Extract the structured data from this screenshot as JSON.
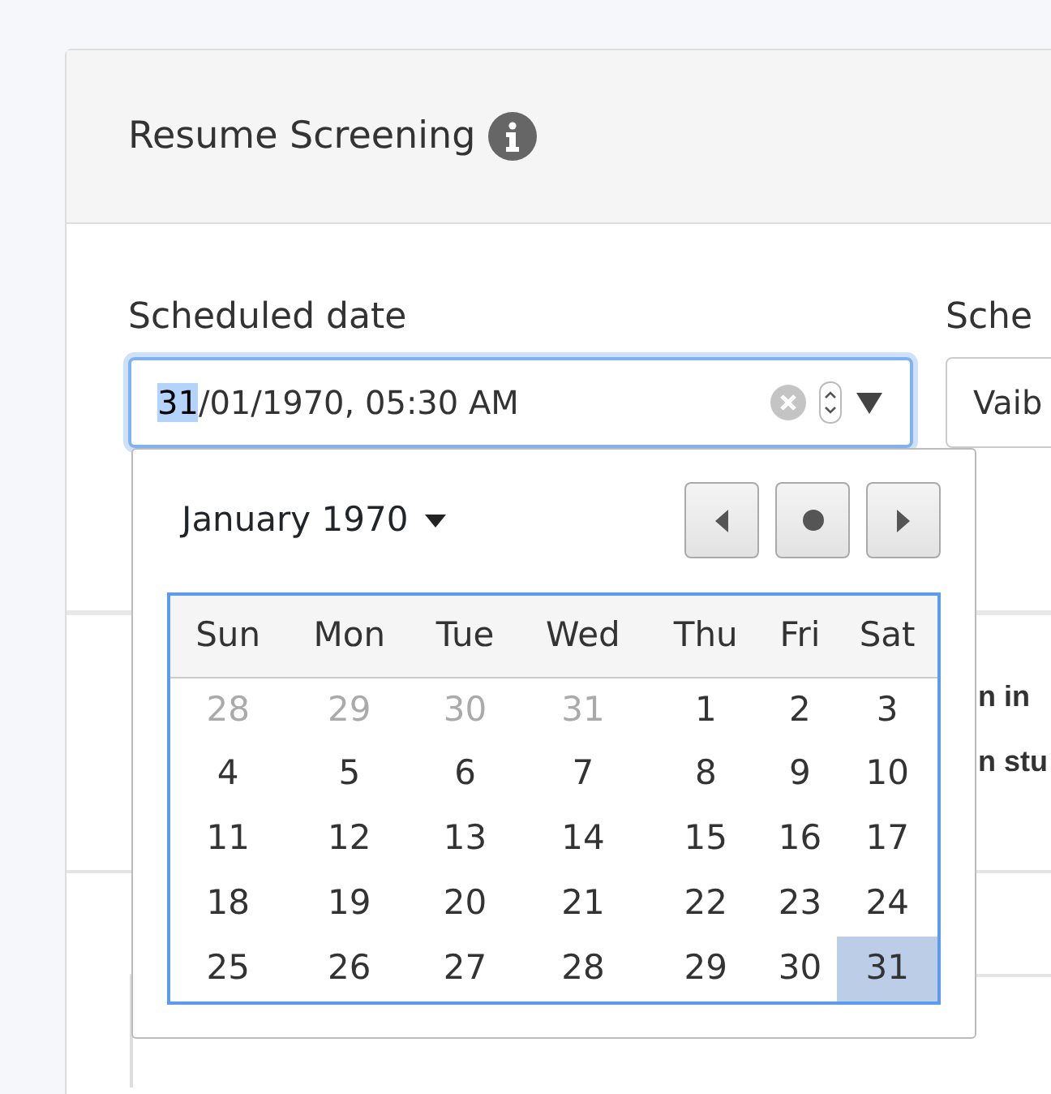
{
  "card": {
    "title": "Resume Screening"
  },
  "fields": [
    {
      "label": "Scheduled date",
      "focused": true,
      "value_parts": [
        {
          "text": "31",
          "selected": true
        },
        {
          "text": "/01/1970, 05:30 AM",
          "selected": false
        }
      ]
    },
    {
      "label": "Sche",
      "focused": false,
      "value_parts": [
        {
          "text": "Vaib",
          "selected": false
        }
      ]
    }
  ],
  "background_lines": [
    "n in",
    "n stu"
  ],
  "calendar": {
    "month": "January 1970",
    "weekdays": [
      "Sun",
      "Mon",
      "Tue",
      "Wed",
      "Thu",
      "Fri",
      "Sat"
    ],
    "weeks": [
      [
        {
          "day": "28",
          "outside": true,
          "selected": false
        },
        {
          "day": "29",
          "outside": true,
          "selected": false
        },
        {
          "day": "30",
          "outside": true,
          "selected": false
        },
        {
          "day": "31",
          "outside": true,
          "selected": false
        },
        {
          "day": "1",
          "outside": false,
          "selected": false
        },
        {
          "day": "2",
          "outside": false,
          "selected": false
        },
        {
          "day": "3",
          "outside": false,
          "selected": false
        }
      ],
      [
        {
          "day": "4",
          "outside": false,
          "selected": false
        },
        {
          "day": "5",
          "outside": false,
          "selected": false
        },
        {
          "day": "6",
          "outside": false,
          "selected": false
        },
        {
          "day": "7",
          "outside": false,
          "selected": false
        },
        {
          "day": "8",
          "outside": false,
          "selected": false
        },
        {
          "day": "9",
          "outside": false,
          "selected": false
        },
        {
          "day": "10",
          "outside": false,
          "selected": false
        }
      ],
      [
        {
          "day": "11",
          "outside": false,
          "selected": false
        },
        {
          "day": "12",
          "outside": false,
          "selected": false
        },
        {
          "day": "13",
          "outside": false,
          "selected": false
        },
        {
          "day": "14",
          "outside": false,
          "selected": false
        },
        {
          "day": "15",
          "outside": false,
          "selected": false
        },
        {
          "day": "16",
          "outside": false,
          "selected": false
        },
        {
          "day": "17",
          "outside": false,
          "selected": false
        }
      ],
      [
        {
          "day": "18",
          "outside": false,
          "selected": false
        },
        {
          "day": "19",
          "outside": false,
          "selected": false
        },
        {
          "day": "20",
          "outside": false,
          "selected": false
        },
        {
          "day": "21",
          "outside": false,
          "selected": false
        },
        {
          "day": "22",
          "outside": false,
          "selected": false
        },
        {
          "day": "23",
          "outside": false,
          "selected": false
        },
        {
          "day": "24",
          "outside": false,
          "selected": false
        }
      ],
      [
        {
          "day": "25",
          "outside": false,
          "selected": false
        },
        {
          "day": "26",
          "outside": false,
          "selected": false
        },
        {
          "day": "27",
          "outside": false,
          "selected": false
        },
        {
          "day": "28",
          "outside": false,
          "selected": false
        },
        {
          "day": "29",
          "outside": false,
          "selected": false
        },
        {
          "day": "30",
          "outside": false,
          "selected": false
        },
        {
          "day": "31",
          "outside": false,
          "selected": true
        }
      ]
    ]
  }
}
